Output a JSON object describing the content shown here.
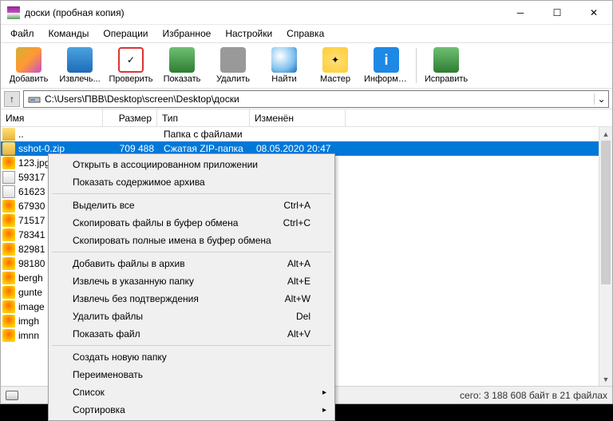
{
  "window": {
    "title": "доски (пробная копия)"
  },
  "menu": [
    "Файл",
    "Команды",
    "Операции",
    "Избранное",
    "Настройки",
    "Справка"
  ],
  "toolbar": [
    {
      "key": "add",
      "label": "Добавить"
    },
    {
      "key": "extract",
      "label": "Извлечь..."
    },
    {
      "key": "test",
      "label": "Проверить"
    },
    {
      "key": "view",
      "label": "Показать"
    },
    {
      "key": "delete",
      "label": "Удалить"
    },
    {
      "key": "find",
      "label": "Найти"
    },
    {
      "key": "wizard",
      "label": "Мастер"
    },
    {
      "key": "info",
      "label": "Информация"
    },
    {
      "key": "repair",
      "label": "Исправить"
    }
  ],
  "address": "C:\\Users\\ПВВ\\Desktop\\screen\\Desktop\\доски",
  "columns": {
    "name": "Имя",
    "size": "Размер",
    "type": "Тип",
    "modified": "Изменён"
  },
  "parent_type": "Папка с файлами",
  "selected": {
    "name": "sshot-0.zip",
    "size": "709 488",
    "type": "Сжатая ZIP-папка",
    "modified": "08.05.2020 20:47"
  },
  "files": [
    "123.jpg",
    "59317",
    "61623",
    "67930",
    "71517",
    "78341",
    "82981",
    "98180",
    "bergh",
    "gunte",
    "image",
    "imgh",
    "imnn"
  ],
  "context_menu": [
    {
      "label": "Открыть в ассоциированном приложении"
    },
    {
      "label": "Показать содержимое архива"
    },
    {
      "sep": true
    },
    {
      "label": "Выделить все",
      "shortcut": "Ctrl+A"
    },
    {
      "label": "Скопировать файлы в буфер обмена",
      "shortcut": "Ctrl+C"
    },
    {
      "label": "Скопировать полные имена в буфер обмена"
    },
    {
      "sep": true
    },
    {
      "label": "Добавить файлы в архив",
      "shortcut": "Alt+A"
    },
    {
      "label": "Извлечь в указанную папку",
      "shortcut": "Alt+E"
    },
    {
      "label": "Извлечь без подтверждения",
      "shortcut": "Alt+W"
    },
    {
      "label": "Удалить файлы",
      "shortcut": "Del"
    },
    {
      "label": "Показать файл",
      "shortcut": "Alt+V"
    },
    {
      "sep": true
    },
    {
      "label": "Создать новую папку"
    },
    {
      "label": "Переименовать"
    },
    {
      "label": "Список",
      "sub": true
    },
    {
      "label": "Сортировка",
      "sub": true
    }
  ],
  "status": "сего: 3 188 608 байт в 21 файлах"
}
